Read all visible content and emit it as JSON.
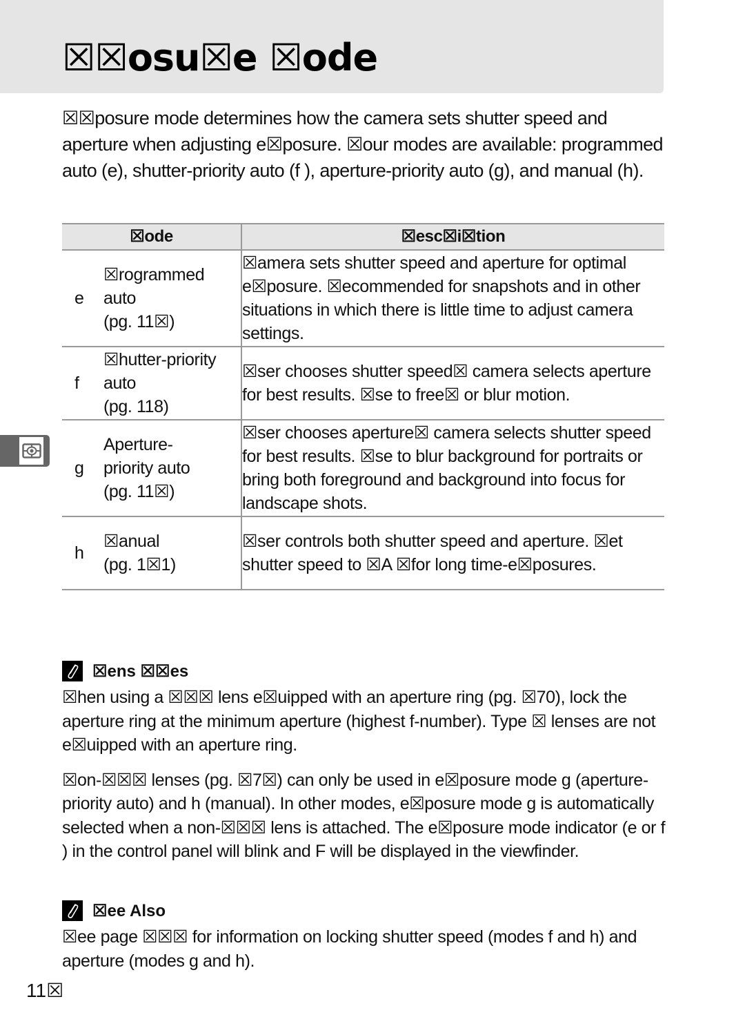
{
  "header": {
    "title": "☒☒osu☒e ☒ode"
  },
  "intro": {
    "text": "☒☒posure mode determines how the camera sets shutter speed and aperture when adjusting e☒posure. ☒our modes are available: programmed auto (e), shutter-priority auto (f ), aperture-priority auto (g), and manual (h)."
  },
  "side_tab": {
    "icon": "exposure-metering-icon"
  },
  "table": {
    "headers": {
      "mode": "☒ode",
      "description": "☒esc☒i☒tion"
    },
    "rows": [
      {
        "letter": "e",
        "name": "☒rogrammed auto (pg. 11☒)",
        "name_lines": [
          "☒rogrammed",
          "auto",
          "(pg. 11☒)"
        ],
        "description": "☒amera sets shutter speed and aperture for optimal e☒posure. ☒ecommended for snapshots and in other situations in which there is little time to adjust camera settings."
      },
      {
        "letter": "f",
        "name": "☒hutter-priority auto (pg. 118)",
        "name_lines": [
          "☒hutter-priority",
          "auto",
          "(pg. 118)"
        ],
        "description": "☒ser chooses shutter speed☒ camera selects aperture for best results. ☒se to free☒ or blur motion."
      },
      {
        "letter": "g",
        "name": "Aperture-priority auto (pg. 11☒)",
        "name_lines": [
          "Aperture-",
          "priority auto",
          "(pg. 11☒)"
        ],
        "description": "☒ser chooses aperture☒ camera selects shutter speed for best results. ☒se to blur background for portraits or bring both foreground and background into focus for landscape shots."
      },
      {
        "letter": "h",
        "name": "☒anual (pg. 1☒1)",
        "name_lines": [
          "☒anual",
          "(pg. 1☒1)"
        ],
        "description": "☒ser controls both shutter speed and aperture. ☒et shutter speed to ☒A      ☒for long time-e☒posures."
      }
    ]
  },
  "notes": [
    {
      "icon": "paperclip-icon",
      "title": "☒ens ☒☒es",
      "paragraphs": [
        "☒hen using a ☒☒☒ lens e☒uipped with    an aperture ring (pg. ☒70), lock the aperture ring at the minimum aperture (highest f-number).  Type ☒ lenses are not e☒uipped with an aperture ring.",
        "☒on-☒☒☒ lenses (pg. ☒7☒) can only be used in e☒posure mode   g (aperture-priority auto) and h (manual).  In other modes, e☒posure mode g is automatically selected when a non-☒☒☒ lens is attached.   The e☒posure mode indicator (e or f ) in the control panel will blink and F  will be displayed in the viewfinder."
      ]
    },
    {
      "icon": "paperclip-icon",
      "title": "☒ee Also",
      "paragraphs": [
        "☒ee page ☒☒☒ for information on locking shutter speed (modes f  and h) and aperture (modes g and h)."
      ]
    }
  ],
  "footer": {
    "page_number": "11☒"
  }
}
